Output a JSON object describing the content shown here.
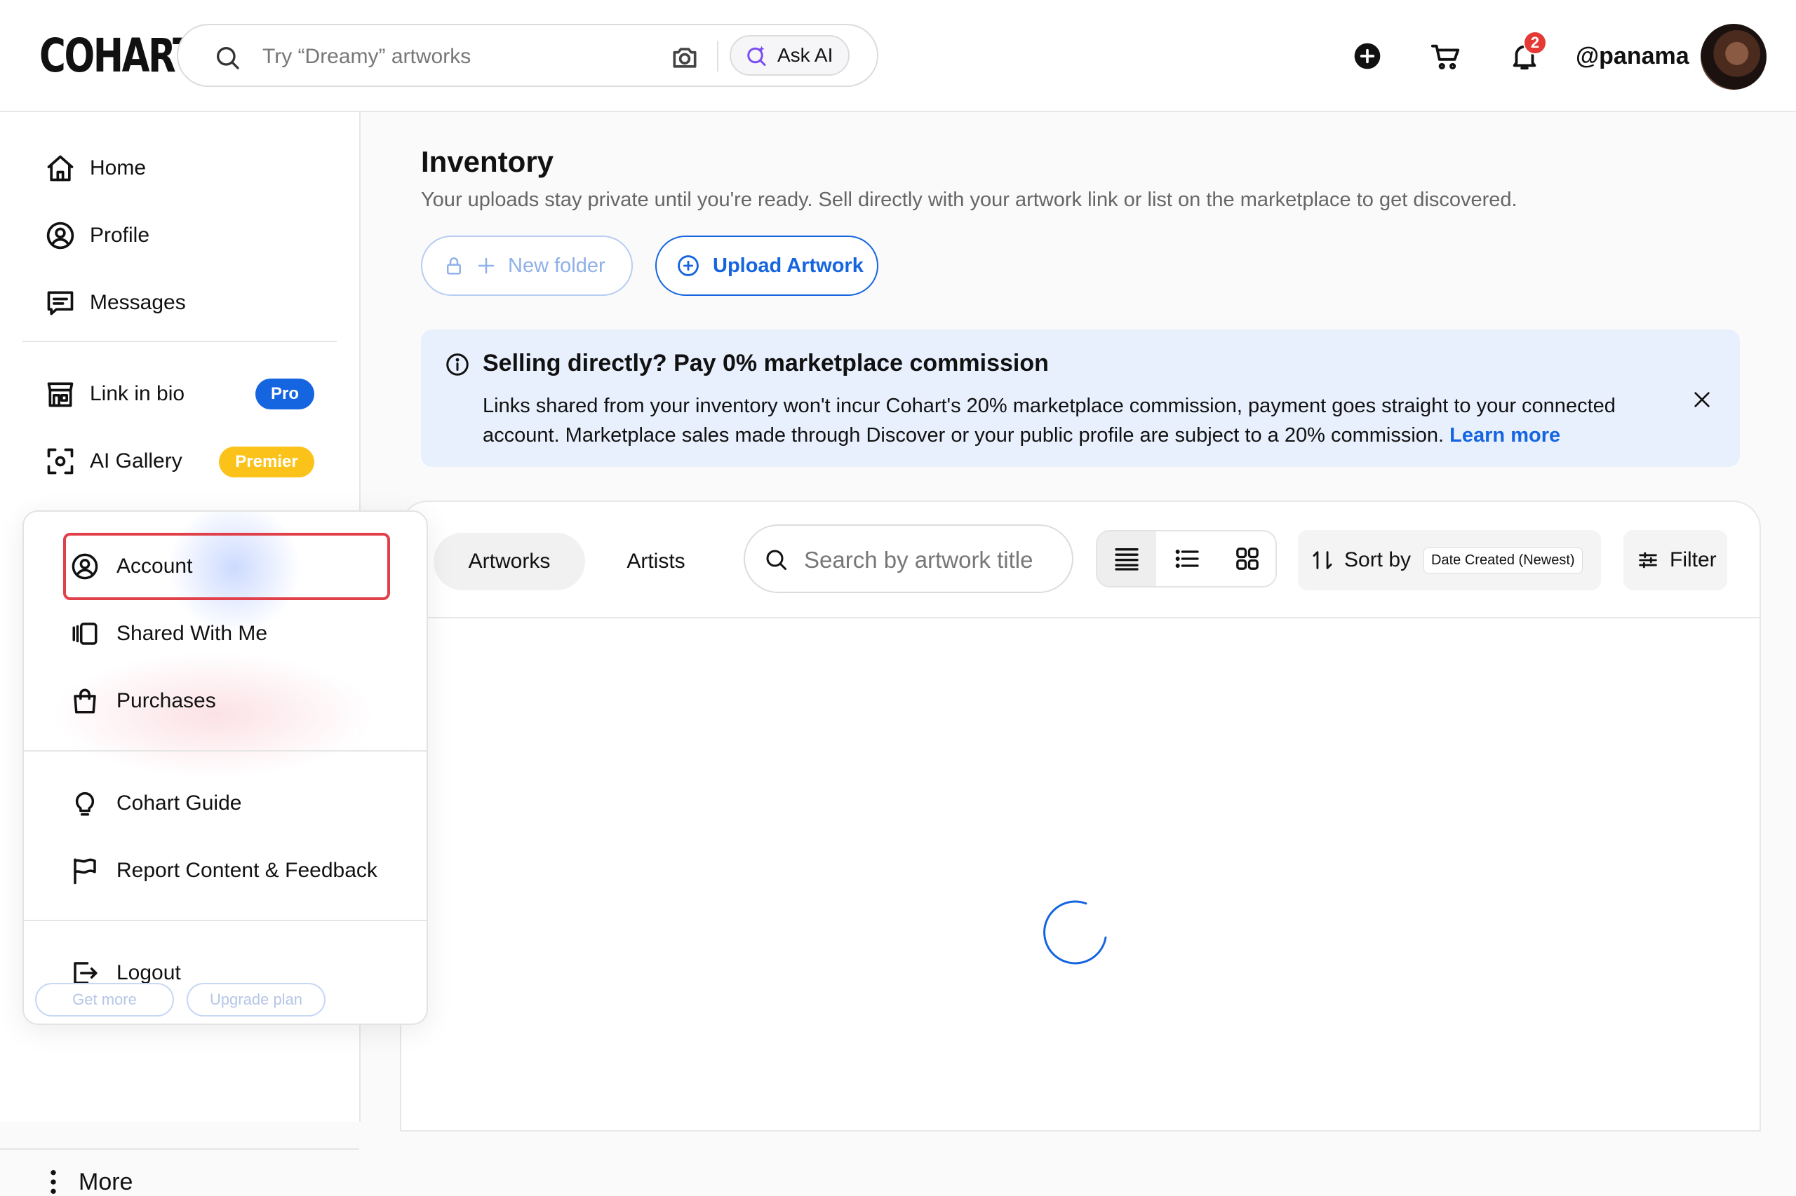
{
  "header": {
    "logo": "COHART",
    "search_placeholder": "Try “Dreamy” artworks",
    "ask_ai_label": "Ask AI",
    "notification_count": "2",
    "username": "@panama"
  },
  "sidebar": {
    "items": [
      {
        "label": "Home"
      },
      {
        "label": "Profile"
      },
      {
        "label": "Messages"
      },
      {
        "label": "Link in bio",
        "badge": "Pro"
      },
      {
        "label": "AI Gallery",
        "badge": "Premier"
      }
    ],
    "more_label": "More"
  },
  "main": {
    "title": "Inventory",
    "subtitle": "Your uploads stay private until you're ready. Sell directly with your artwork link or list on the marketplace to get discovered.",
    "new_folder_label": "New folder",
    "upload_label": "Upload Artwork",
    "notice": {
      "title": "Selling directly? Pay 0% marketplace commission",
      "body": "Links shared from your inventory won't incur Cohart's 20% marketplace commission, payment goes straight to your connected account. Marketplace sales made through Discover or your public profile are subject to a 20% commission.",
      "link": "Learn more"
    },
    "tabs": [
      {
        "label": "Artworks",
        "active": true
      },
      {
        "label": "Artists",
        "active": false
      }
    ],
    "search_placeholder": "Search by artwork title",
    "sort_label": "Sort by",
    "sort_value": "Date Created (Newest)",
    "filter_label": "Filter"
  },
  "menu": {
    "items": [
      {
        "label": "Account",
        "icon": "user-circle-icon"
      },
      {
        "label": "Shared With Me",
        "icon": "shared-cards-icon"
      },
      {
        "label": "Purchases",
        "icon": "shopping-bag-icon"
      },
      {
        "label": "Cohart Guide",
        "icon": "lightbulb-icon"
      },
      {
        "label": "Report Content & Feedback",
        "icon": "flag-icon"
      },
      {
        "label": "Logout",
        "icon": "logout-icon"
      }
    ],
    "ghost_buttons": [
      "Get more",
      "Upgrade plan"
    ]
  },
  "colors": {
    "accent": "#1565e0",
    "premier": "#fbc21a",
    "notice_bg": "#e8f0fd",
    "highlight": "#e0404a",
    "badge_red": "#e53935"
  }
}
